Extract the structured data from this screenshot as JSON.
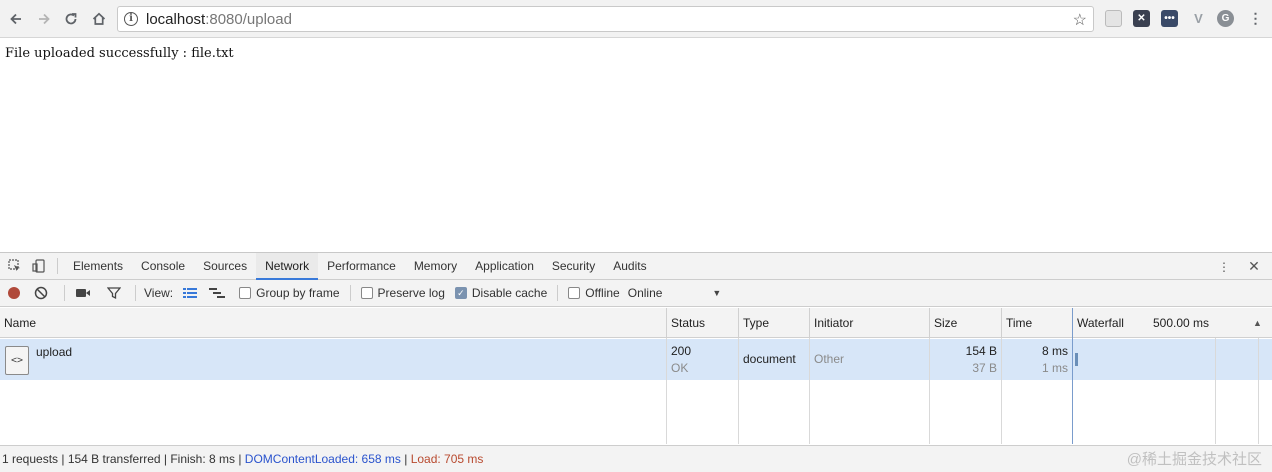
{
  "browser": {
    "url_host": "localhost",
    "url_rest": ":8080/upload"
  },
  "page": {
    "message": "File uploaded successfully : file.txt"
  },
  "devtools": {
    "tabs": [
      "Elements",
      "Console",
      "Sources",
      "Network",
      "Performance",
      "Memory",
      "Application",
      "Security",
      "Audits"
    ],
    "active_tab": "Network",
    "toolbar": {
      "view_label": "View:",
      "group_by_frame": "Group by frame",
      "preserve_log": "Preserve log",
      "disable_cache": "Disable cache",
      "offline": "Offline",
      "throttle": "Online"
    },
    "columns": {
      "name": "Name",
      "status": "Status",
      "type": "Type",
      "initiator": "Initiator",
      "size": "Size",
      "time": "Time",
      "waterfall": "Waterfall",
      "waterfall_scale": "500.00 ms"
    },
    "row": {
      "name": "upload",
      "status_code": "200",
      "status_text": "OK",
      "type": "document",
      "initiator": "Other",
      "size_transferred": "154 B",
      "size_content": "37 B",
      "time_total": "8 ms",
      "time_latency": "1 ms"
    },
    "summary": {
      "main": "1 requests | 154 B transferred | Finish: 8 ms | ",
      "dcl": "DOMContentLoaded: 658 ms",
      "sep": " | ",
      "load": "Load: 705 ms"
    },
    "watermark": "@稀土掘金技术社区"
  }
}
